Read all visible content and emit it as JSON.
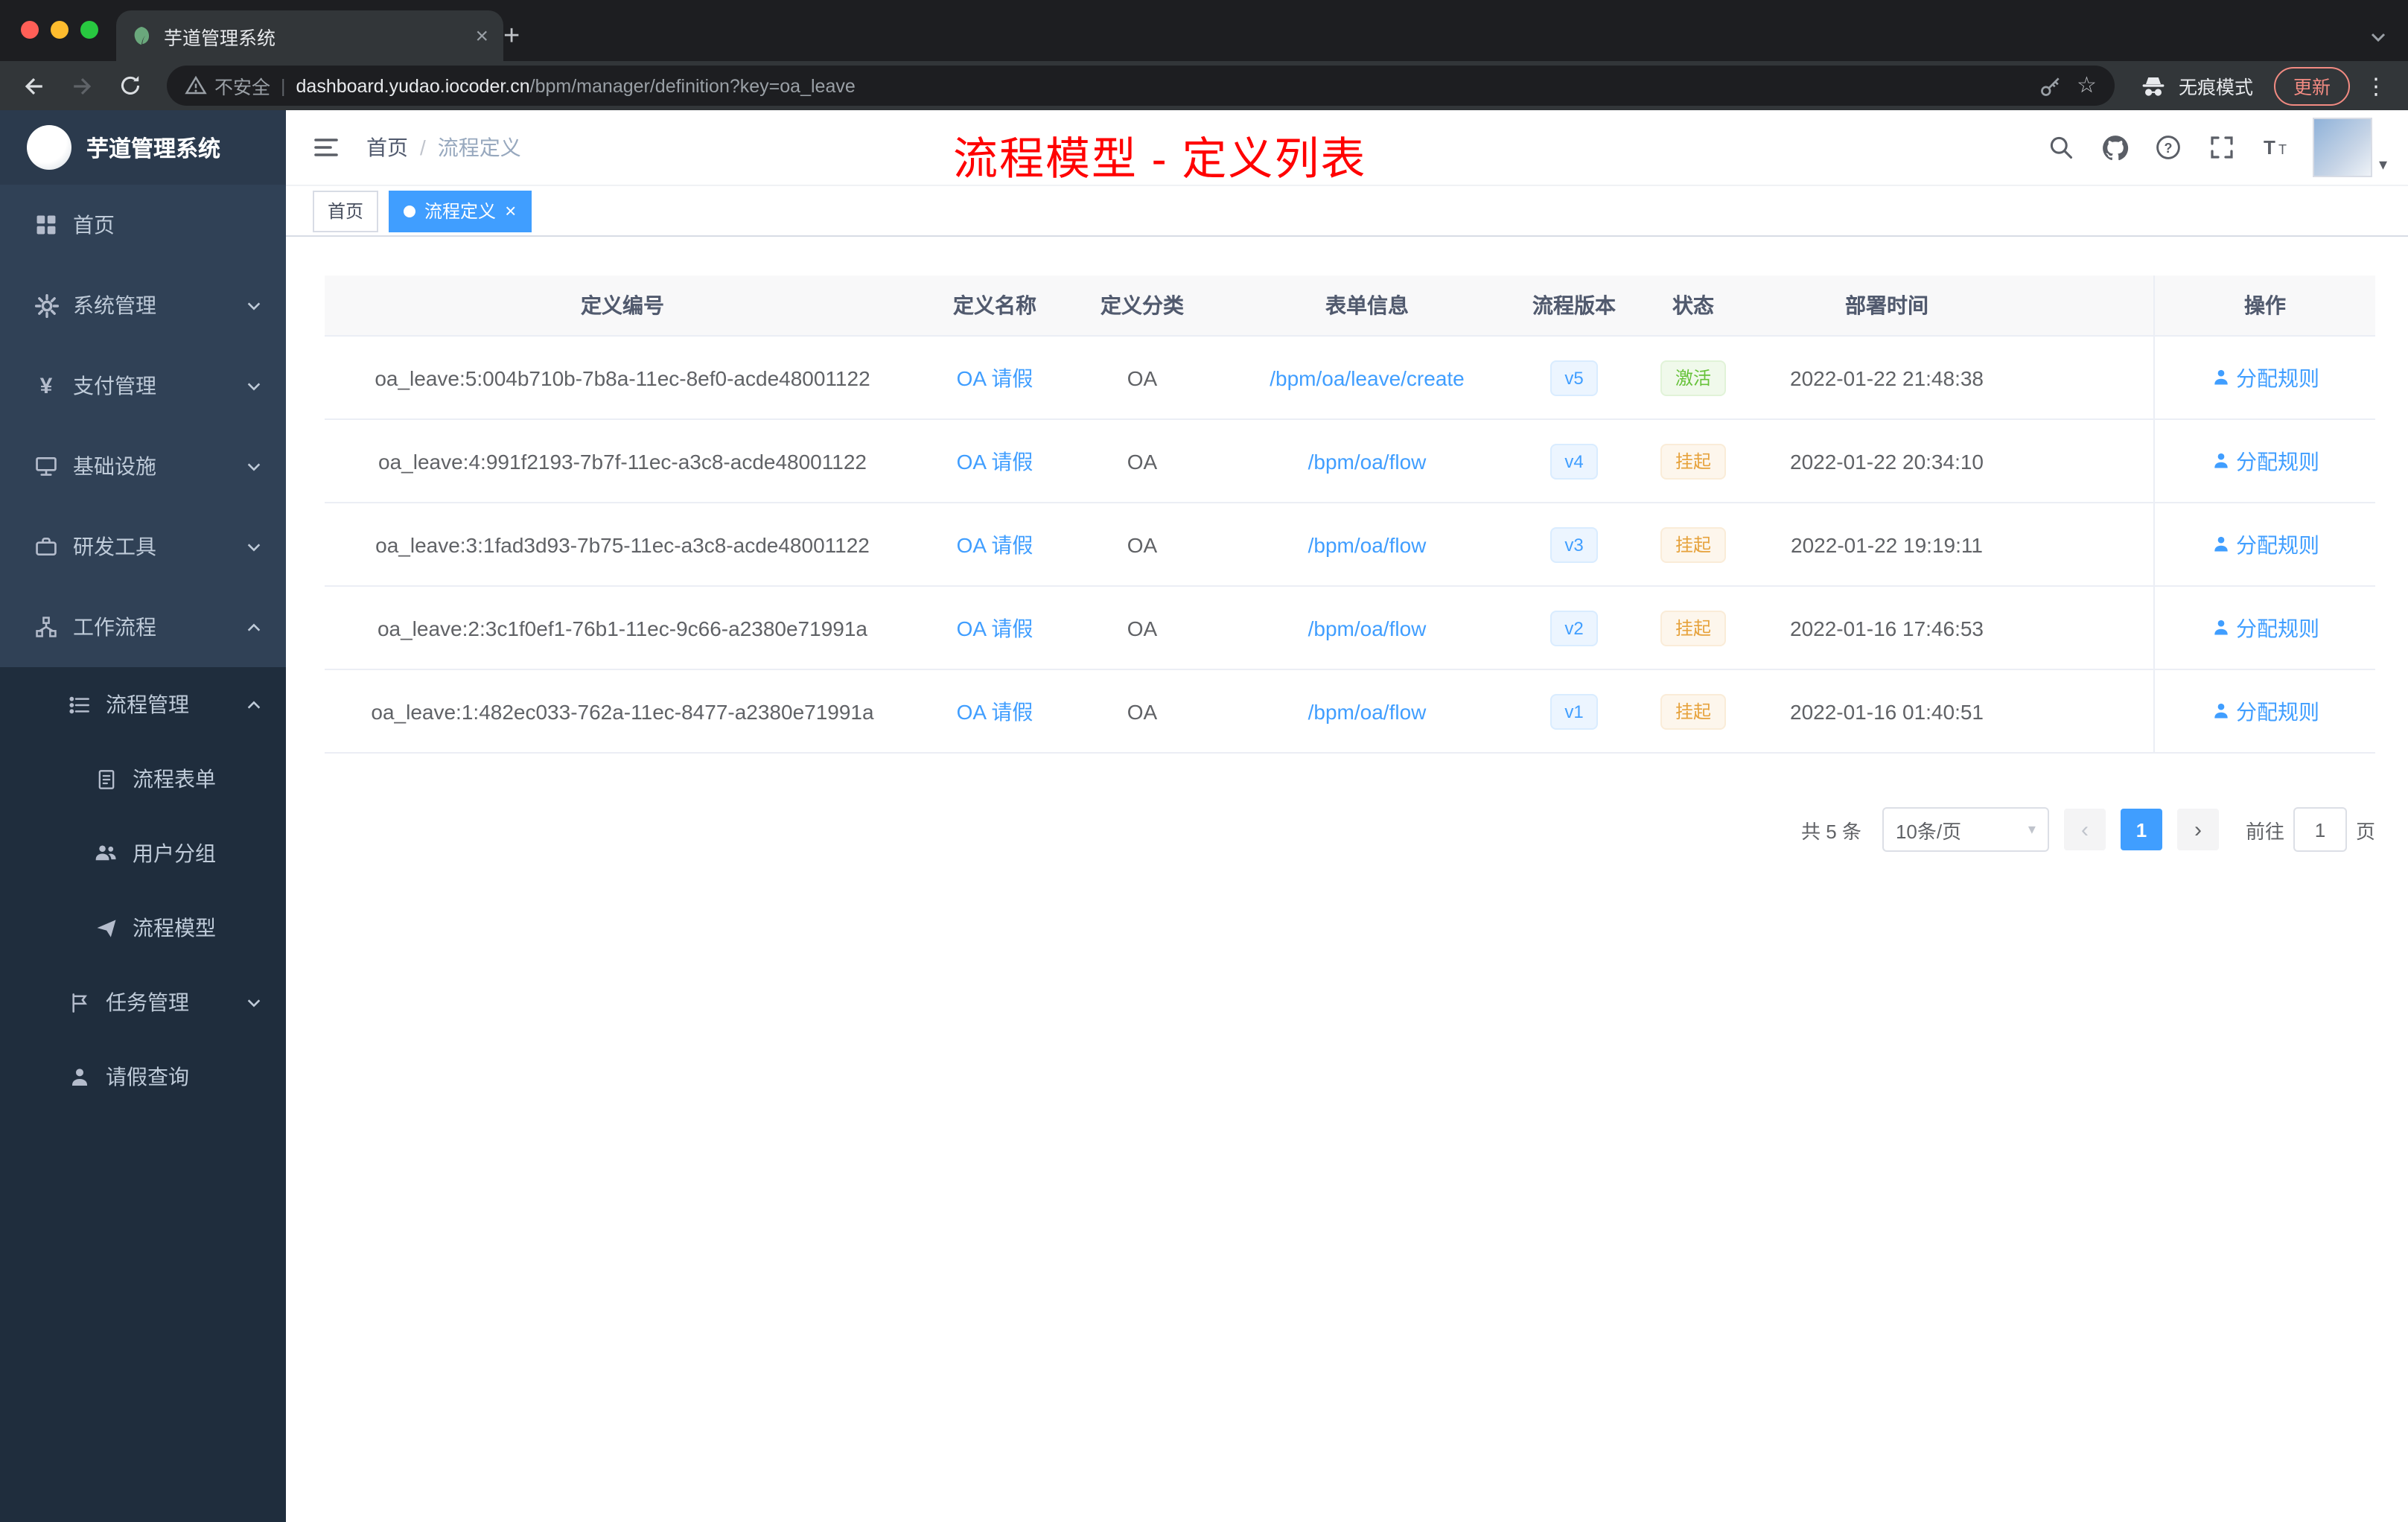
{
  "icons": {
    "close": "×",
    "plus": "+",
    "kebab": "⋮",
    "star": "☆",
    "yen": "¥",
    "caret_down": "▾",
    "prev": "‹",
    "next": "›",
    "slash": "/",
    "pipe": "|"
  },
  "browser": {
    "tab_title": "芋道管理系统",
    "security_label": "不安全",
    "url_host": "dashboard.yudao.iocoder.cn",
    "url_path": "/bpm/manager/definition?key=oa_leave",
    "incognito_label": "无痕模式",
    "update_label": "更新"
  },
  "sidebar": {
    "logo_title": "芋道管理系统",
    "items": [
      {
        "label": "首页",
        "level": 1
      },
      {
        "label": "系统管理",
        "level": 1,
        "chevron": "down"
      },
      {
        "label": "支付管理",
        "level": 1,
        "chevron": "down"
      },
      {
        "label": "基础设施",
        "level": 1,
        "chevron": "down"
      },
      {
        "label": "研发工具",
        "level": 1,
        "chevron": "down"
      },
      {
        "label": "工作流程",
        "level": 1,
        "chevron": "up"
      },
      {
        "label": "流程管理",
        "level": 2,
        "chevron": "up"
      },
      {
        "label": "流程表单",
        "level": 3
      },
      {
        "label": "用户分组",
        "level": 3
      },
      {
        "label": "流程模型",
        "level": 3
      },
      {
        "label": "任务管理",
        "level": 2,
        "chevron": "down"
      },
      {
        "label": "请假查询",
        "level": 2
      }
    ]
  },
  "header": {
    "breadcrumb": {
      "home": "首页",
      "current": "流程定义"
    },
    "annotation": "流程模型 - 定义列表"
  },
  "tags_view": {
    "tags": [
      {
        "label": "首页",
        "active": false
      },
      {
        "label": "流程定义",
        "active": true
      }
    ]
  },
  "table": {
    "columns": [
      "定义编号",
      "定义名称",
      "定义分类",
      "表单信息",
      "流程版本",
      "状态",
      "部署时间",
      "操作"
    ],
    "rows": [
      {
        "id": "oa_leave:5:004b710b-7b8a-11ec-8ef0-acde48001122",
        "name": "OA 请假",
        "category": "OA",
        "form": "/bpm/oa/leave/create",
        "version": "v5",
        "status": "激活",
        "status_type": "success",
        "time": "2022-01-22 21:48:38",
        "action": "分配规则"
      },
      {
        "id": "oa_leave:4:991f2193-7b7f-11ec-a3c8-acde48001122",
        "name": "OA 请假",
        "category": "OA",
        "form": "/bpm/oa/flow",
        "version": "v4",
        "status": "挂起",
        "status_type": "warning",
        "time": "2022-01-22 20:34:10",
        "action": "分配规则"
      },
      {
        "id": "oa_leave:3:1fad3d93-7b75-11ec-a3c8-acde48001122",
        "name": "OA 请假",
        "category": "OA",
        "form": "/bpm/oa/flow",
        "version": "v3",
        "status": "挂起",
        "status_type": "warning",
        "time": "2022-01-22 19:19:11",
        "action": "分配规则"
      },
      {
        "id": "oa_leave:2:3c1f0ef1-76b1-11ec-9c66-a2380e71991a",
        "name": "OA 请假",
        "category": "OA",
        "form": "/bpm/oa/flow",
        "version": "v2",
        "status": "挂起",
        "status_type": "warning",
        "time": "2022-01-16 17:46:53",
        "action": "分配规则"
      },
      {
        "id": "oa_leave:1:482ec033-762a-11ec-8477-a2380e71991a",
        "name": "OA 请假",
        "category": "OA",
        "form": "/bpm/oa/flow",
        "version": "v1",
        "status": "挂起",
        "status_type": "warning",
        "time": "2022-01-16 01:40:51",
        "action": "分配规则"
      }
    ]
  },
  "pagination": {
    "total": "共 5 条",
    "page_size": "10条/页",
    "current_page": "1",
    "goto_label": "前往",
    "goto_value": "1",
    "goto_unit": "页"
  }
}
